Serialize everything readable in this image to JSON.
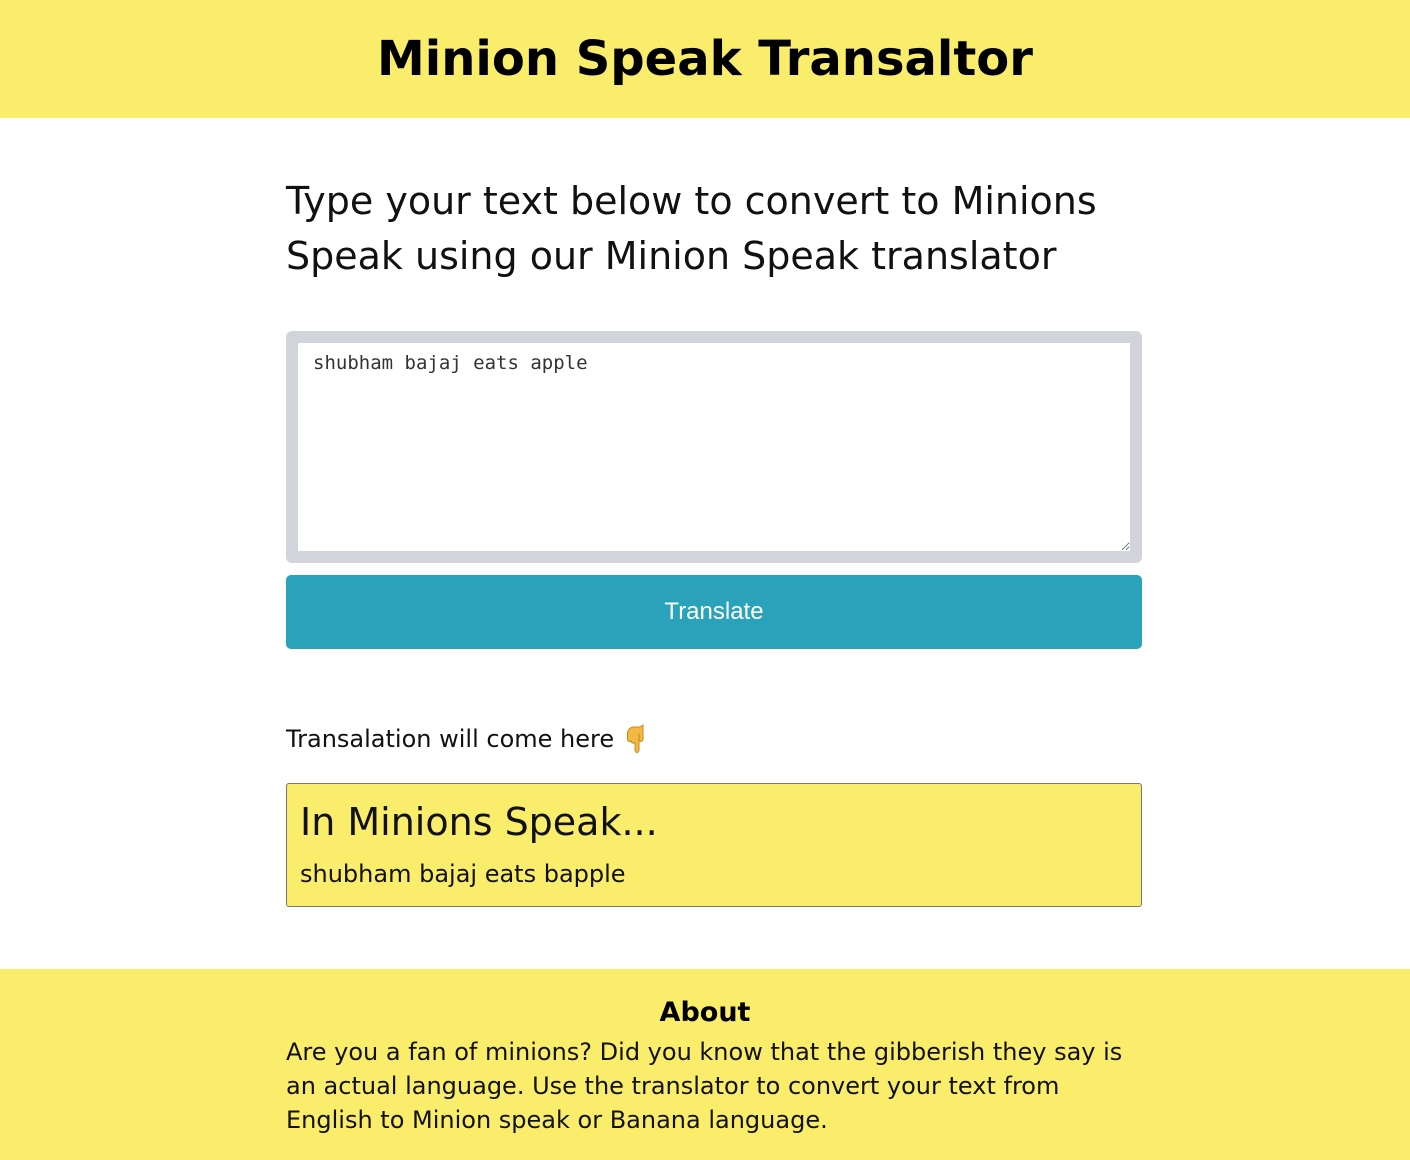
{
  "header": {
    "title": "Minion Speak Transaltor"
  },
  "intro": {
    "text": "Type your text below to convert to Minions Speak using our Minion Speak translator"
  },
  "input": {
    "value": "shubham bajaj eats apple"
  },
  "translate_button": {
    "label": "Translate"
  },
  "output": {
    "label": "Transalation will come here",
    "label_icon": "pointing-down-hand-icon",
    "heading": "In Minions Speak...",
    "result": "shubham bajaj eats bapple"
  },
  "footer": {
    "heading": "About",
    "text": "Are you a fan of minions? Did you know that the gibberish they say is an actual language. Use the translator to convert your text from English to Minion speak or Banana language."
  },
  "colors": {
    "brand_yellow": "#faed6c",
    "button_teal": "#2aa2ba",
    "input_border_gray": "#d1d5db"
  }
}
